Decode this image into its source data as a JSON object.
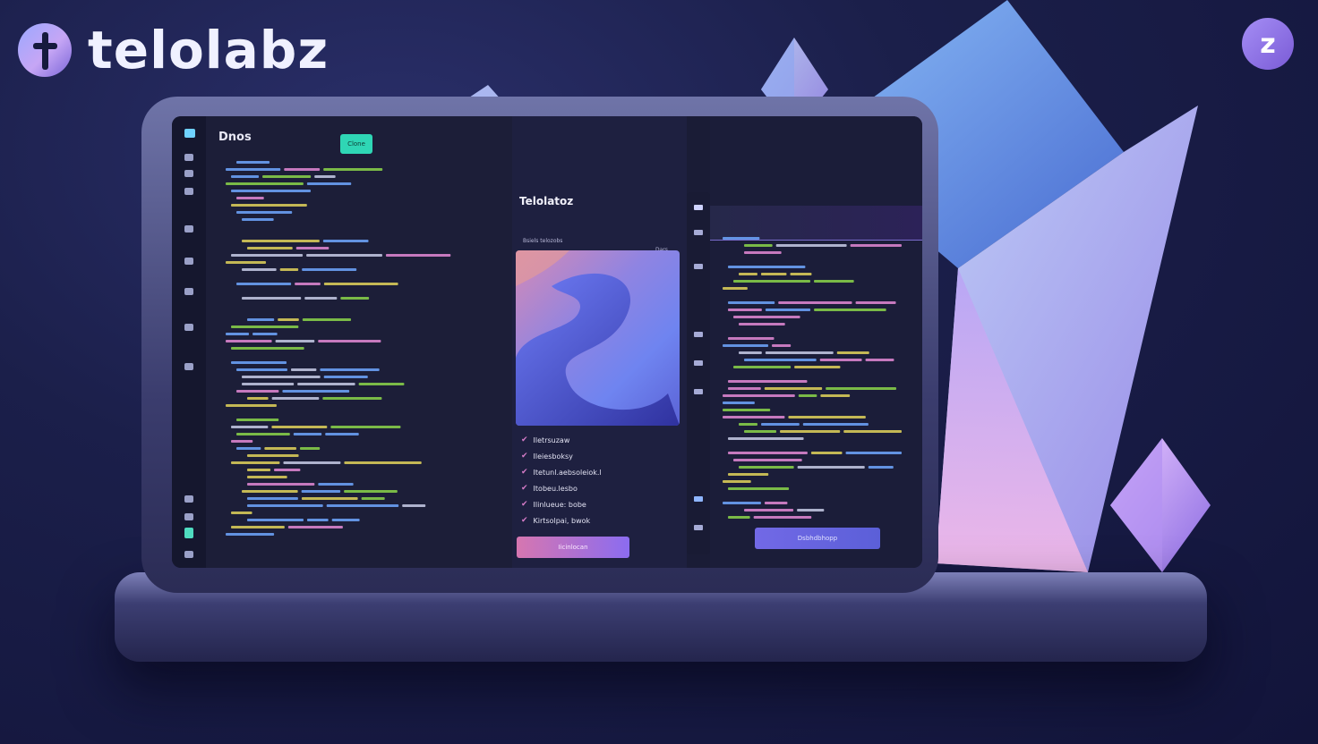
{
  "brand": {
    "name": "telolabz",
    "badge_letter": "z"
  },
  "screen": {
    "app_title": "Dnos",
    "code_button_label": "Clone",
    "center": {
      "title": "Telolatoz",
      "subtitle": "Bsiels telozobs",
      "subtitle_right": "Dars",
      "checklist": [
        {
          "label": "Iletrsuzaw"
        },
        {
          "label": "Ileiesboksy"
        },
        {
          "label": "Itetunl.aebsoleiok.l"
        },
        {
          "label": "Itobeu.lesbo"
        },
        {
          "label": "Ilinlueue: bobe"
        },
        {
          "label": "Kirtsolpai, bwok"
        }
      ],
      "button_label": "Iicinlocan"
    },
    "right": {
      "button_label": "Dsbhdbhopp"
    }
  },
  "colors": {
    "background": "#1b1f4a",
    "accent_teal": "#2fd6b5",
    "accent_pink": "#d676b0",
    "accent_purple": "#7269e6",
    "code_green": "#8bd64a",
    "code_yellow": "#e2d45a",
    "code_blue": "#6fa7ff",
    "code_pink": "#e48ad6"
  },
  "icons": [
    "plus-logo-icon",
    "zigzag-app-icon",
    "check-icon",
    "star-icon"
  ]
}
